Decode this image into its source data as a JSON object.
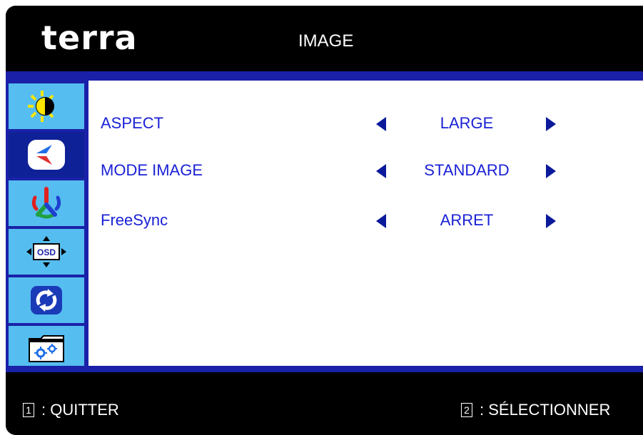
{
  "brand": {
    "logo_text": "terra"
  },
  "header": {
    "title": "IMAGE"
  },
  "sidebar": {
    "tabs": [
      {
        "icon": "brightness-contrast-icon",
        "active": false
      },
      {
        "icon": "image-icon",
        "active": true
      },
      {
        "icon": "color-icon",
        "active": false
      },
      {
        "icon": "osd-settings-icon",
        "active": false
      },
      {
        "icon": "reset-icon",
        "active": false
      },
      {
        "icon": "other-settings-icon",
        "active": false
      }
    ]
  },
  "settings": [
    {
      "label": "ASPECT",
      "value": "LARGE"
    },
    {
      "label": "MODE IMAGE",
      "value": "STANDARD"
    },
    {
      "label": "FreeSync",
      "value": "ARRET"
    }
  ],
  "footer": {
    "quit_key": "1",
    "quit_label": ": QUITTER",
    "select_key": "2",
    "select_label": ": SÉLECTIONNER"
  },
  "colors": {
    "background": "#000000",
    "accent_bar": "#1a21a8",
    "tab_inactive": "#55bdf0",
    "tab_active": "#0f2196",
    "text_blue": "#1a21d6",
    "arrow": "#0b1a9a"
  }
}
